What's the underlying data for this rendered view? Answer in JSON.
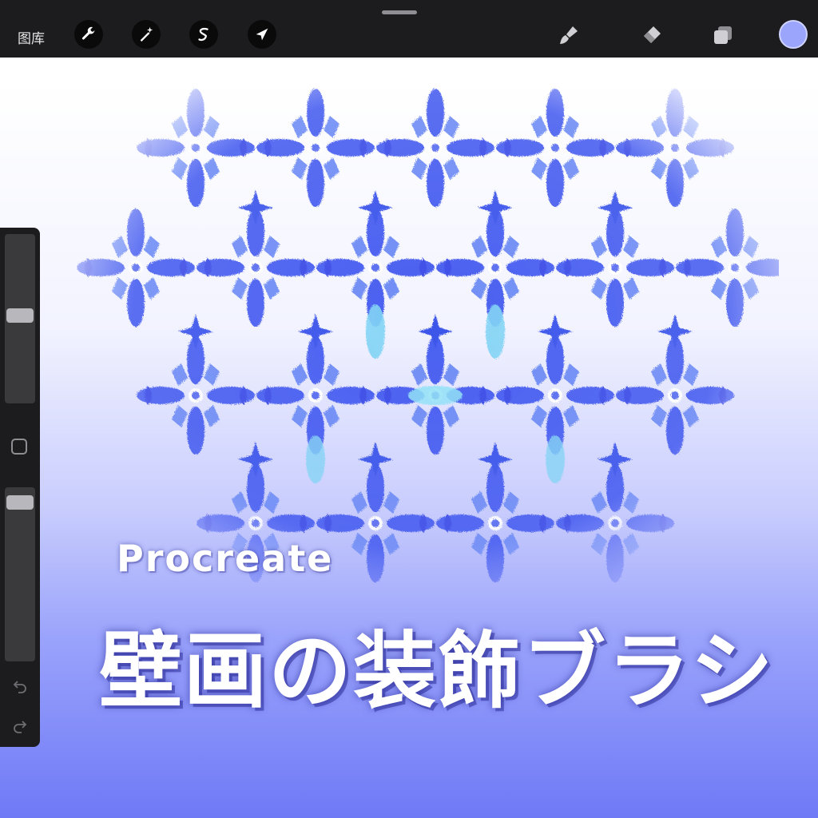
{
  "toolbar": {
    "gallery_label": "图库",
    "tools": [
      {
        "name": "wrench-icon",
        "label": "Actions"
      },
      {
        "name": "magic-wand-icon",
        "label": "Adjustments"
      },
      {
        "name": "selection-icon",
        "label": "Selection"
      },
      {
        "name": "arrow-cursor-icon",
        "label": "Transform"
      }
    ],
    "right_tools": [
      {
        "name": "brush-icon"
      },
      {
        "name": "eraser-icon"
      },
      {
        "name": "layers-icon"
      }
    ],
    "current_color": "#9aa5fb"
  },
  "sidebar": {
    "brush_size_level": 0.52,
    "opacity_level": 0.04
  },
  "overlay": {
    "app_name": "Procreate",
    "title": "壁画の装飾ブラシ"
  },
  "colors": {
    "pattern_dark": "#3d4ee6",
    "pattern_mid": "#5f7bf2",
    "pattern_light": "#7fd3f4",
    "gradient_bottom": "#6f79f6"
  }
}
